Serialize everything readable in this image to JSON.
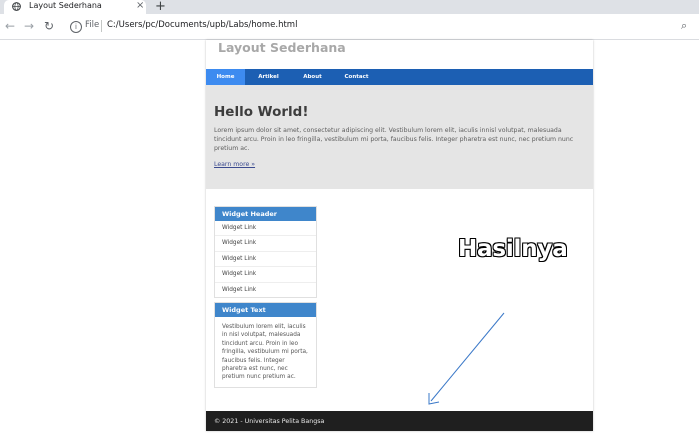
{
  "browser": {
    "tab_title": "Layout Sederhana",
    "close_glyph": "×",
    "new_tab_glyph": "+",
    "back_glyph": "←",
    "forward_glyph": "→",
    "reload_glyph": "↻",
    "scheme_label": "File",
    "url": "C:/Users/pc/Documents/upb/Labs/home.html",
    "info_glyph": "i",
    "zoom_glyph": "⌕",
    "icons": [
      "globe-icon",
      "close-icon",
      "plus-icon",
      "back-arrow-icon",
      "forward-arrow-icon",
      "reload-icon",
      "info-icon",
      "search-zoom-icon"
    ]
  },
  "site": {
    "title": "Layout Sederhana",
    "nav": [
      {
        "label": "Home",
        "active": true
      },
      {
        "label": "Artikel",
        "active": false
      },
      {
        "label": "About",
        "active": false
      },
      {
        "label": "Contact",
        "active": false
      }
    ],
    "hero": {
      "heading": "Hello World!",
      "body": "Lorem ipsum dolor sit amet, consectetur adipiscing elit. Vestibulum lorem elit, iaculis innisl volutpat, malesuada tincidunt arcu. Proin in leo fringilla, vestibulum mi porta, faucibus felis. Integer pharetra est nunc, nec pretium nunc pretium ac.",
      "link": "Learn more »"
    },
    "widget_links": {
      "header": "Widget Header",
      "items": [
        "Widget Link",
        "Widget Link",
        "Widget Link",
        "Widget Link",
        "Widget Link"
      ]
    },
    "widget_text": {
      "header": "Widget Text",
      "body": "Vestibulum lorem elit, iaculis in nisl volutpat, malesuada tincidunt arcu. Proin in leo fringilla, vestibulum mi porta, faucibus felis. Integer pharetra est nunc, nec pretium nunc pretium ac."
    },
    "footer": "© 2021 - Universitas Pelita Bangsa"
  },
  "annotation": {
    "label": "Hasilnya"
  },
  "colors": {
    "navbar": "#1c5fb3",
    "nav_active": "#3d8bf0",
    "widget_header": "#3f86cb",
    "hero_bg": "#e5e5e5",
    "footer_bg": "#1f1f1f",
    "arrow": "#3a78c8"
  }
}
